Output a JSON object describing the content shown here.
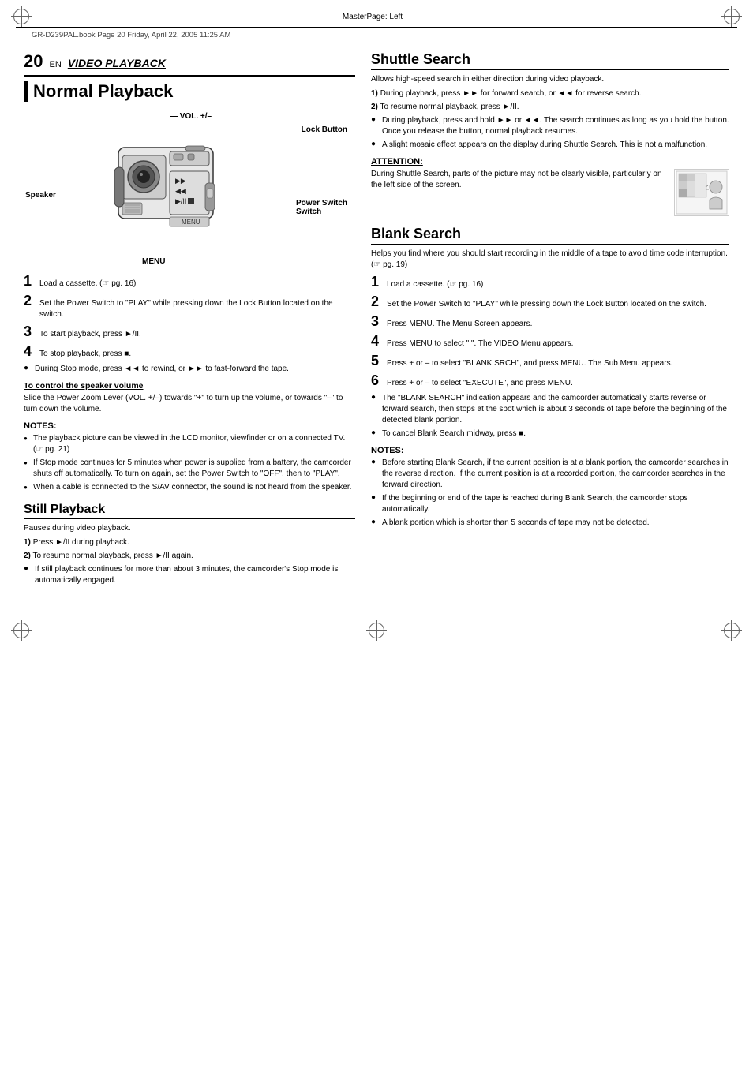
{
  "page": {
    "masterpage": "MasterPage: Left",
    "fileinfo": "GR-D239PAL.book  Page 20  Friday, April 22, 2005  11:25 AM",
    "page_number": "20",
    "page_number_sub": "EN",
    "section_title": "VIDEO PLAYBACK",
    "main_heading": "Normal Playback"
  },
  "diagram": {
    "labels": {
      "vol": "VOL. +/–",
      "lock": "Lock Button",
      "speaker": "Speaker",
      "power": "Power Switch",
      "menu": "MENU"
    }
  },
  "normal_playback": {
    "steps": [
      {
        "num": "1",
        "text": "Load a cassette. (☞ pg. 16)"
      },
      {
        "num": "2",
        "text": "Set the Power Switch to \"PLAY\" while pressing down the Lock Button located on the switch."
      },
      {
        "num": "3",
        "text": "To start playback, press ►/II."
      },
      {
        "num": "4",
        "text": "To stop playback, press ■."
      }
    ],
    "stop_mode_note": "During Stop mode, press ◄◄ to rewind, or ►► to fast-forward the tape.",
    "speaker_volume_heading": "To control the speaker volume",
    "speaker_volume_text": "Slide the Power Zoom Lever (VOL. +/–) towards \"+\" to turn up the volume, or towards \"–\" to turn down the volume.",
    "notes_heading": "NOTES:",
    "notes": [
      "The playback picture can be viewed in the LCD monitor, viewfinder or on a connected TV. (☞ pg. 21)",
      "If Stop mode continues for 5 minutes when power is supplied from a battery, the camcorder shuts off automatically. To turn on again, set the Power Switch to \"OFF\", then to \"PLAY\".",
      "When a cable is connected to the S/AV connector, the sound is not heard from the speaker."
    ]
  },
  "still_playback": {
    "heading": "Still Playback",
    "intro": "Pauses during video playback.",
    "steps": [
      {
        "num": "1)",
        "text": "Press ►/II during playback."
      },
      {
        "num": "2)",
        "text": "To resume normal playback, press ►/II again."
      }
    ],
    "notes": [
      "If still playback continues for more than about 3 minutes, the camcorder's Stop mode is automatically engaged."
    ]
  },
  "shuttle_search": {
    "heading": "Shuttle Search",
    "intro": "Allows high-speed search in either direction during video playback.",
    "steps": [
      {
        "num": "1)",
        "text": "During playback, press ►► for forward search, or ◄◄ for reverse search."
      },
      {
        "num": "2)",
        "text": "To resume normal playback, press ►/II."
      }
    ],
    "notes": [
      "During playback, press and hold ►► or ◄◄. The search continues as long as you hold the button. Once you release the button, normal playback resumes.",
      "A slight mosaic effect appears on the display during Shuttle Search. This is not a malfunction."
    ],
    "attention_heading": "ATTENTION:",
    "attention_text": "During Shuttle Search, parts of the picture may not be clearly visible, particularly on the left side of the screen."
  },
  "blank_search": {
    "heading": "Blank Search",
    "intro": "Helps you find where you should start recording in the middle of a tape to avoid time code interruption. (☞ pg. 19)",
    "steps": [
      {
        "num": "1",
        "text": "Load a cassette. (☞ pg. 16)"
      },
      {
        "num": "2",
        "text": "Set the Power Switch to \"PLAY\" while pressing down the Lock Button located on the switch."
      },
      {
        "num": "3",
        "text": "Press MENU. The Menu Screen appears."
      },
      {
        "num": "4",
        "text": "Press MENU to select \"  \". The VIDEO Menu appears."
      },
      {
        "num": "5",
        "text": "Press + or – to select \"BLANK SRCH\", and press MENU. The Sub Menu appears."
      },
      {
        "num": "6",
        "text": "Press + or – to select \"EXECUTE\", and press MENU."
      }
    ],
    "notes_heading": "NOTES:",
    "notes": [
      "The \"BLANK SEARCH\" indication appears and the camcorder automatically starts reverse or forward search, then stops at the spot which is about 3 seconds of tape before the beginning of the detected blank portion.",
      "To cancel Blank Search midway, press ■."
    ],
    "notes2_heading": "NOTES:",
    "notes2": [
      "Before starting Blank Search, if the current position is at a blank portion, the camcorder searches in the reverse direction. If the current position is at a recorded portion, the camcorder searches in the forward direction.",
      "If the beginning or end of the tape is reached during Blank Search, the camcorder stops automatically.",
      "A blank portion which is shorter than 5 seconds of tape may not be detected."
    ]
  }
}
